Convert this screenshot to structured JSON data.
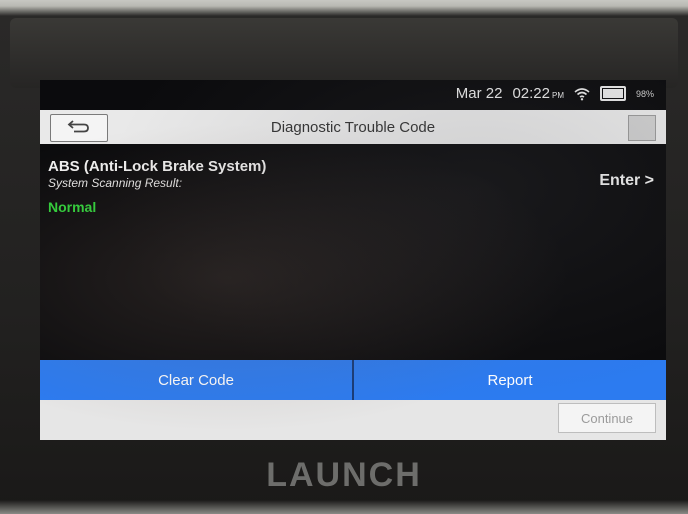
{
  "statusbar": {
    "date": "Mar 22",
    "time": "02:22",
    "ampm": "PM",
    "battery": "98%"
  },
  "titlebar": {
    "title": "Diagnostic Trouble Code"
  },
  "system": {
    "name": "ABS (Anti-Lock Brake System)",
    "scan_label": "System Scanning Result:",
    "result": "Normal",
    "enter_label": "Enter >"
  },
  "actions": {
    "clear_code": "Clear Code",
    "report": "Report",
    "continue": "Continue"
  },
  "brand": "LAUNCH",
  "colors": {
    "accent": "#2c7bf0",
    "status_ok": "#2fd43a"
  }
}
